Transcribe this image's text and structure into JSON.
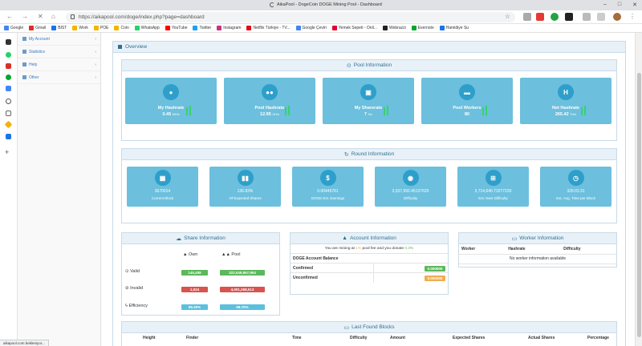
{
  "browser": {
    "tab_title": "AikaPool - DogeCoin DOGE Mining Pool - Dashboard",
    "url": "https://aikapool.com/doge/index.php?page=dashboard",
    "bookmarks": [
      {
        "label": "Google",
        "color": "#4285f4"
      },
      {
        "label": "Gmail",
        "color": "#d93025"
      },
      {
        "label": "BIST",
        "color": "#1a73e8"
      },
      {
        "label": "Work",
        "color": "#f4b400"
      },
      {
        "label": "POE",
        "color": "#f4b400"
      },
      {
        "label": "Coin",
        "color": "#f4b400"
      },
      {
        "label": "WhatsApp",
        "color": "#25d366"
      },
      {
        "label": "YouTube",
        "color": "#ff0000"
      },
      {
        "label": "Twitter",
        "color": "#1da1f2"
      },
      {
        "label": "Instagram",
        "color": "#c13584"
      },
      {
        "label": "Netflix Türkiye - TV...",
        "color": "#e50914"
      },
      {
        "label": "Google Çeviri",
        "color": "#4285f4"
      },
      {
        "label": "Yemek Sepeti - Onli...",
        "color": "#e4002b"
      },
      {
        "label": "Webrazzi",
        "color": "#222222"
      },
      {
        "label": "Evernote",
        "color": "#00a82d"
      },
      {
        "label": "Hamidiye Su",
        "color": "#1a73e8"
      }
    ],
    "status_text": "aikapool.com bekleniyor..."
  },
  "sidebar": {
    "items": [
      "My Account",
      "Statistics",
      "Help",
      "Other"
    ]
  },
  "overview": {
    "title": "Overview",
    "pool_info": {
      "title": "Pool Information",
      "cards": [
        {
          "label": "My Hashrate",
          "value": "0.45",
          "unit": "MH/s"
        },
        {
          "label": "Pool Hashrate",
          "value": "12.95",
          "unit": "GH/s"
        },
        {
          "label": "My Sharerate",
          "value": "7",
          "unit": "S/s"
        },
        {
          "label": "Pool Workers",
          "value": "80",
          "unit": ""
        },
        {
          "label": "Net Hashrate",
          "value": "265.42",
          "unit": "TH/s"
        }
      ]
    },
    "round_info": {
      "title": "Round Information",
      "cards": [
        {
          "value": "3670014",
          "label": "Current Block"
        },
        {
          "value": "136.83%",
          "label": "Of Expected Shares"
        },
        {
          "value": "0.00445761",
          "label": "DOGE Est. Earnings"
        },
        {
          "value": "3,537,992.45137620",
          "label": "Difficulty"
        },
        {
          "value": "3,714,640.73277220",
          "label": "Est. Next Difficulty"
        },
        {
          "value": "326:01:31",
          "label": "Est. Avg. Time per Block"
        }
      ]
    },
    "share_info": {
      "title": "Share Information",
      "col_own": "Own",
      "col_pool": "Pool",
      "rows": [
        {
          "label": "Valid",
          "own": "145,408",
          "pool": "322,045,957,904"
        },
        {
          "label": "Invalid",
          "own": "1,024",
          "pool": "4,001,268,513"
        },
        {
          "label": "Efficiency",
          "own": "99.30%",
          "pool": "98.75%"
        }
      ]
    },
    "account_info": {
      "title": "Account Information",
      "note_a": "You are mining at",
      "fee": "1%",
      "note_b": "pool fee and you donate",
      "donate": "0.3%",
      "balance_title": "DOGE Account Balance",
      "confirmed_label": "Confirmed",
      "confirmed_value": "0.000000",
      "unconfirmed_label": "Unconfirmed",
      "unconfirmed_value": "0.000000"
    },
    "worker_info": {
      "title": "Worker Information",
      "cols": [
        "Worker",
        "Hashrate",
        "Difficulty"
      ],
      "empty": "No worker information available"
    },
    "blocks": {
      "title": "Last Found Blocks",
      "cols": [
        "Height",
        "Finder",
        "Time",
        "Difficulty",
        "Amount",
        "Expected Shares",
        "Actual Shares",
        "Percentage"
      ]
    }
  }
}
